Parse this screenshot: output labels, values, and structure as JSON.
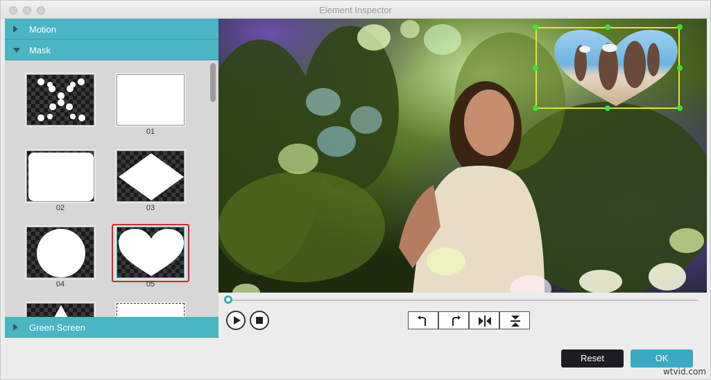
{
  "window": {
    "title": "Element Inspector"
  },
  "sections": {
    "motion": {
      "label": "Motion"
    },
    "mask": {
      "label": "Mask"
    },
    "green_screen": {
      "label": "Green Screen"
    }
  },
  "masks": [
    {
      "label": "",
      "shape": "dots-x",
      "selected": false
    },
    {
      "label": "01",
      "shape": "rounded-rect-small",
      "selected": false
    },
    {
      "label": "02",
      "shape": "rounded-rect",
      "selected": false
    },
    {
      "label": "03",
      "shape": "diamond",
      "selected": false
    },
    {
      "label": "04",
      "shape": "circle",
      "selected": false
    },
    {
      "label": "05",
      "shape": "heart",
      "selected": true
    }
  ],
  "player": {
    "play_icon": "play-icon",
    "stop_icon": "stop-icon",
    "progress": 0,
    "tools": [
      {
        "name": "rotate-left-icon"
      },
      {
        "name": "rotate-right-icon"
      },
      {
        "name": "flip-horizontal-icon"
      },
      {
        "name": "flip-vertical-icon"
      }
    ]
  },
  "buttons": {
    "reset": "Reset",
    "ok": "OK"
  },
  "watermark": "wtvid.com",
  "colors": {
    "accent": "#4ab5c3",
    "selection": "#d8262c",
    "pip_border": "#e6e62a",
    "handle": "#38e23a"
  }
}
